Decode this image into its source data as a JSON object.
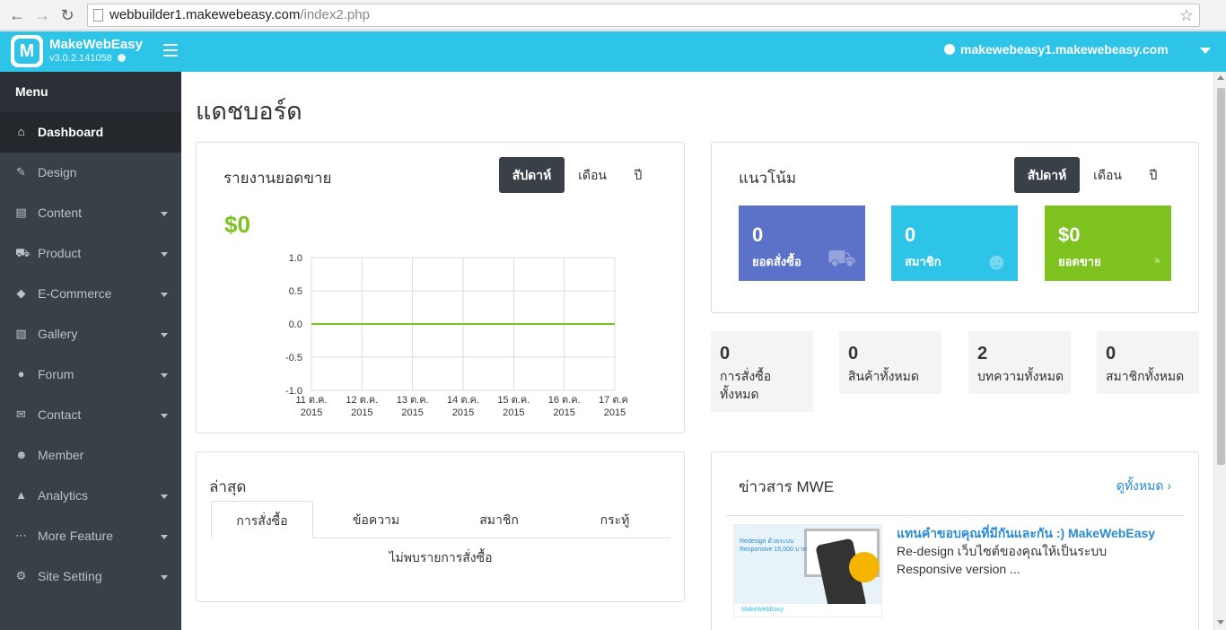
{
  "browser": {
    "url_host": "webbuilder1.makewebeasy.com",
    "url_path": "/index2.php"
  },
  "header": {
    "app_name": "MakeWebEasy",
    "version": "v3.0.2.141058",
    "site": "makewebeasy1.makewebeasy.com",
    "logo_letter": "M"
  },
  "sidebar": {
    "title": "Menu",
    "items": [
      {
        "label": "Dashboard",
        "icon": "home-icon",
        "glyph": "⌂",
        "active": true,
        "chevron": false
      },
      {
        "label": "Design",
        "icon": "brush-icon",
        "glyph": "✎",
        "active": false,
        "chevron": false
      },
      {
        "label": "Content",
        "icon": "file-icon",
        "glyph": "▤",
        "active": false,
        "chevron": true
      },
      {
        "label": "Product",
        "icon": "cart-icon",
        "glyph": "⛟",
        "active": false,
        "chevron": true
      },
      {
        "label": "E-Commerce",
        "icon": "tag-icon",
        "glyph": "◆",
        "active": false,
        "chevron": true
      },
      {
        "label": "Gallery",
        "icon": "picture-icon",
        "glyph": "▨",
        "active": false,
        "chevron": true
      },
      {
        "label": "Forum",
        "icon": "comments-icon",
        "glyph": "●",
        "active": false,
        "chevron": true
      },
      {
        "label": "Contact",
        "icon": "envelope-icon",
        "glyph": "✉",
        "active": false,
        "chevron": true
      },
      {
        "label": "Member",
        "icon": "users-icon",
        "glyph": "☻",
        "active": false,
        "chevron": false
      },
      {
        "label": "Analytics",
        "icon": "area-chart-icon",
        "glyph": "▲",
        "active": false,
        "chevron": true
      },
      {
        "label": "More Feature",
        "icon": "ellipsis-icon",
        "glyph": "⋯",
        "active": false,
        "chevron": true
      },
      {
        "label": "Site Setting",
        "icon": "gear-icon",
        "glyph": "⚙",
        "active": false,
        "chevron": true
      }
    ]
  },
  "page": {
    "title": "แดชบอร์ด"
  },
  "sales": {
    "title": "รายงานยอดขาย",
    "amount": "$0",
    "periods": [
      "สัปดาห์",
      "เดือน",
      "ปี"
    ],
    "active_period": 0
  },
  "chart_data": {
    "type": "line",
    "title": "",
    "x": [
      "11 ต.ค. 2015",
      "12 ต.ค. 2015",
      "13 ต.ค. 2015",
      "14 ต.ค. 2015",
      "15 ต.ค. 2015",
      "16 ต.ค. 2015",
      "17 ต.ค. 2015"
    ],
    "x_ticks": [
      [
        "11 ต.ค.",
        "2015"
      ],
      [
        "12 ต.ค.",
        "2015"
      ],
      [
        "13 ต.ค.",
        "2015"
      ],
      [
        "14 ต.ค.",
        "2015"
      ],
      [
        "15 ต.ค.",
        "2015"
      ],
      [
        "16 ต.ค.",
        "2015"
      ],
      [
        "17 ต.ค.",
        "2015"
      ]
    ],
    "series": [
      {
        "values": [
          0,
          0,
          0,
          0,
          0,
          0,
          0
        ],
        "color": "#7dc21e"
      }
    ],
    "ylim": [
      -1.0,
      1.0
    ],
    "y_ticks": [
      "1.0",
      "0.5",
      "0.0",
      "-0.5",
      "-1.0"
    ],
    "grid": true,
    "xlabel": "",
    "ylabel": ""
  },
  "trend": {
    "title": "แนวโน้ม",
    "periods": [
      "สัปดาห์",
      "เดือน",
      "ปี"
    ],
    "active_period": 0,
    "tiles": [
      {
        "value": "0",
        "label": "ยอดสั่งซื้อ",
        "color": "#5b72c8",
        "icon": "cart-icon",
        "glyph": "⛟"
      },
      {
        "value": "0",
        "label": "สมาชิก",
        "color": "#2ec4e8",
        "icon": "users-icon",
        "glyph": "☻"
      },
      {
        "value": "$0",
        "label": "ยอดขาย",
        "color": "#7dc21e",
        "icon": "pie-chart-icon",
        "glyph": "◔"
      }
    ]
  },
  "stats": [
    {
      "value": "0",
      "label": "การสั่งซื้อทั้งหมด"
    },
    {
      "value": "0",
      "label": "สินค้าทั้งหมด"
    },
    {
      "value": "2",
      "label": "บทความทั้งหมด"
    },
    {
      "value": "0",
      "label": "สมาชิกทั้งหมด"
    }
  ],
  "latest": {
    "title": "ล่าสุด",
    "tabs": [
      "การสั่งซื้อ",
      "ข้อความ",
      "สมาชิก",
      "กระทู้"
    ],
    "active_tab": 0,
    "empty_text": "ไม่พบรายการสั่งซื้อ"
  },
  "news": {
    "title": "ข่าวสาร MWE",
    "view_all": "ดูทั้งหมด ›",
    "items": [
      {
        "headline": "แทนคำขอบคุณที่มีกันและกัน :) MakeWebEasy",
        "body": "Re-design เว็บไซต์ของคุณให้เป็นระบบ Responsive version ...",
        "thumb_text": "Redesign ด้วยระบบ Responsive 15,000 บาท",
        "thumb_footer": "MakeWebEasy"
      }
    ]
  }
}
